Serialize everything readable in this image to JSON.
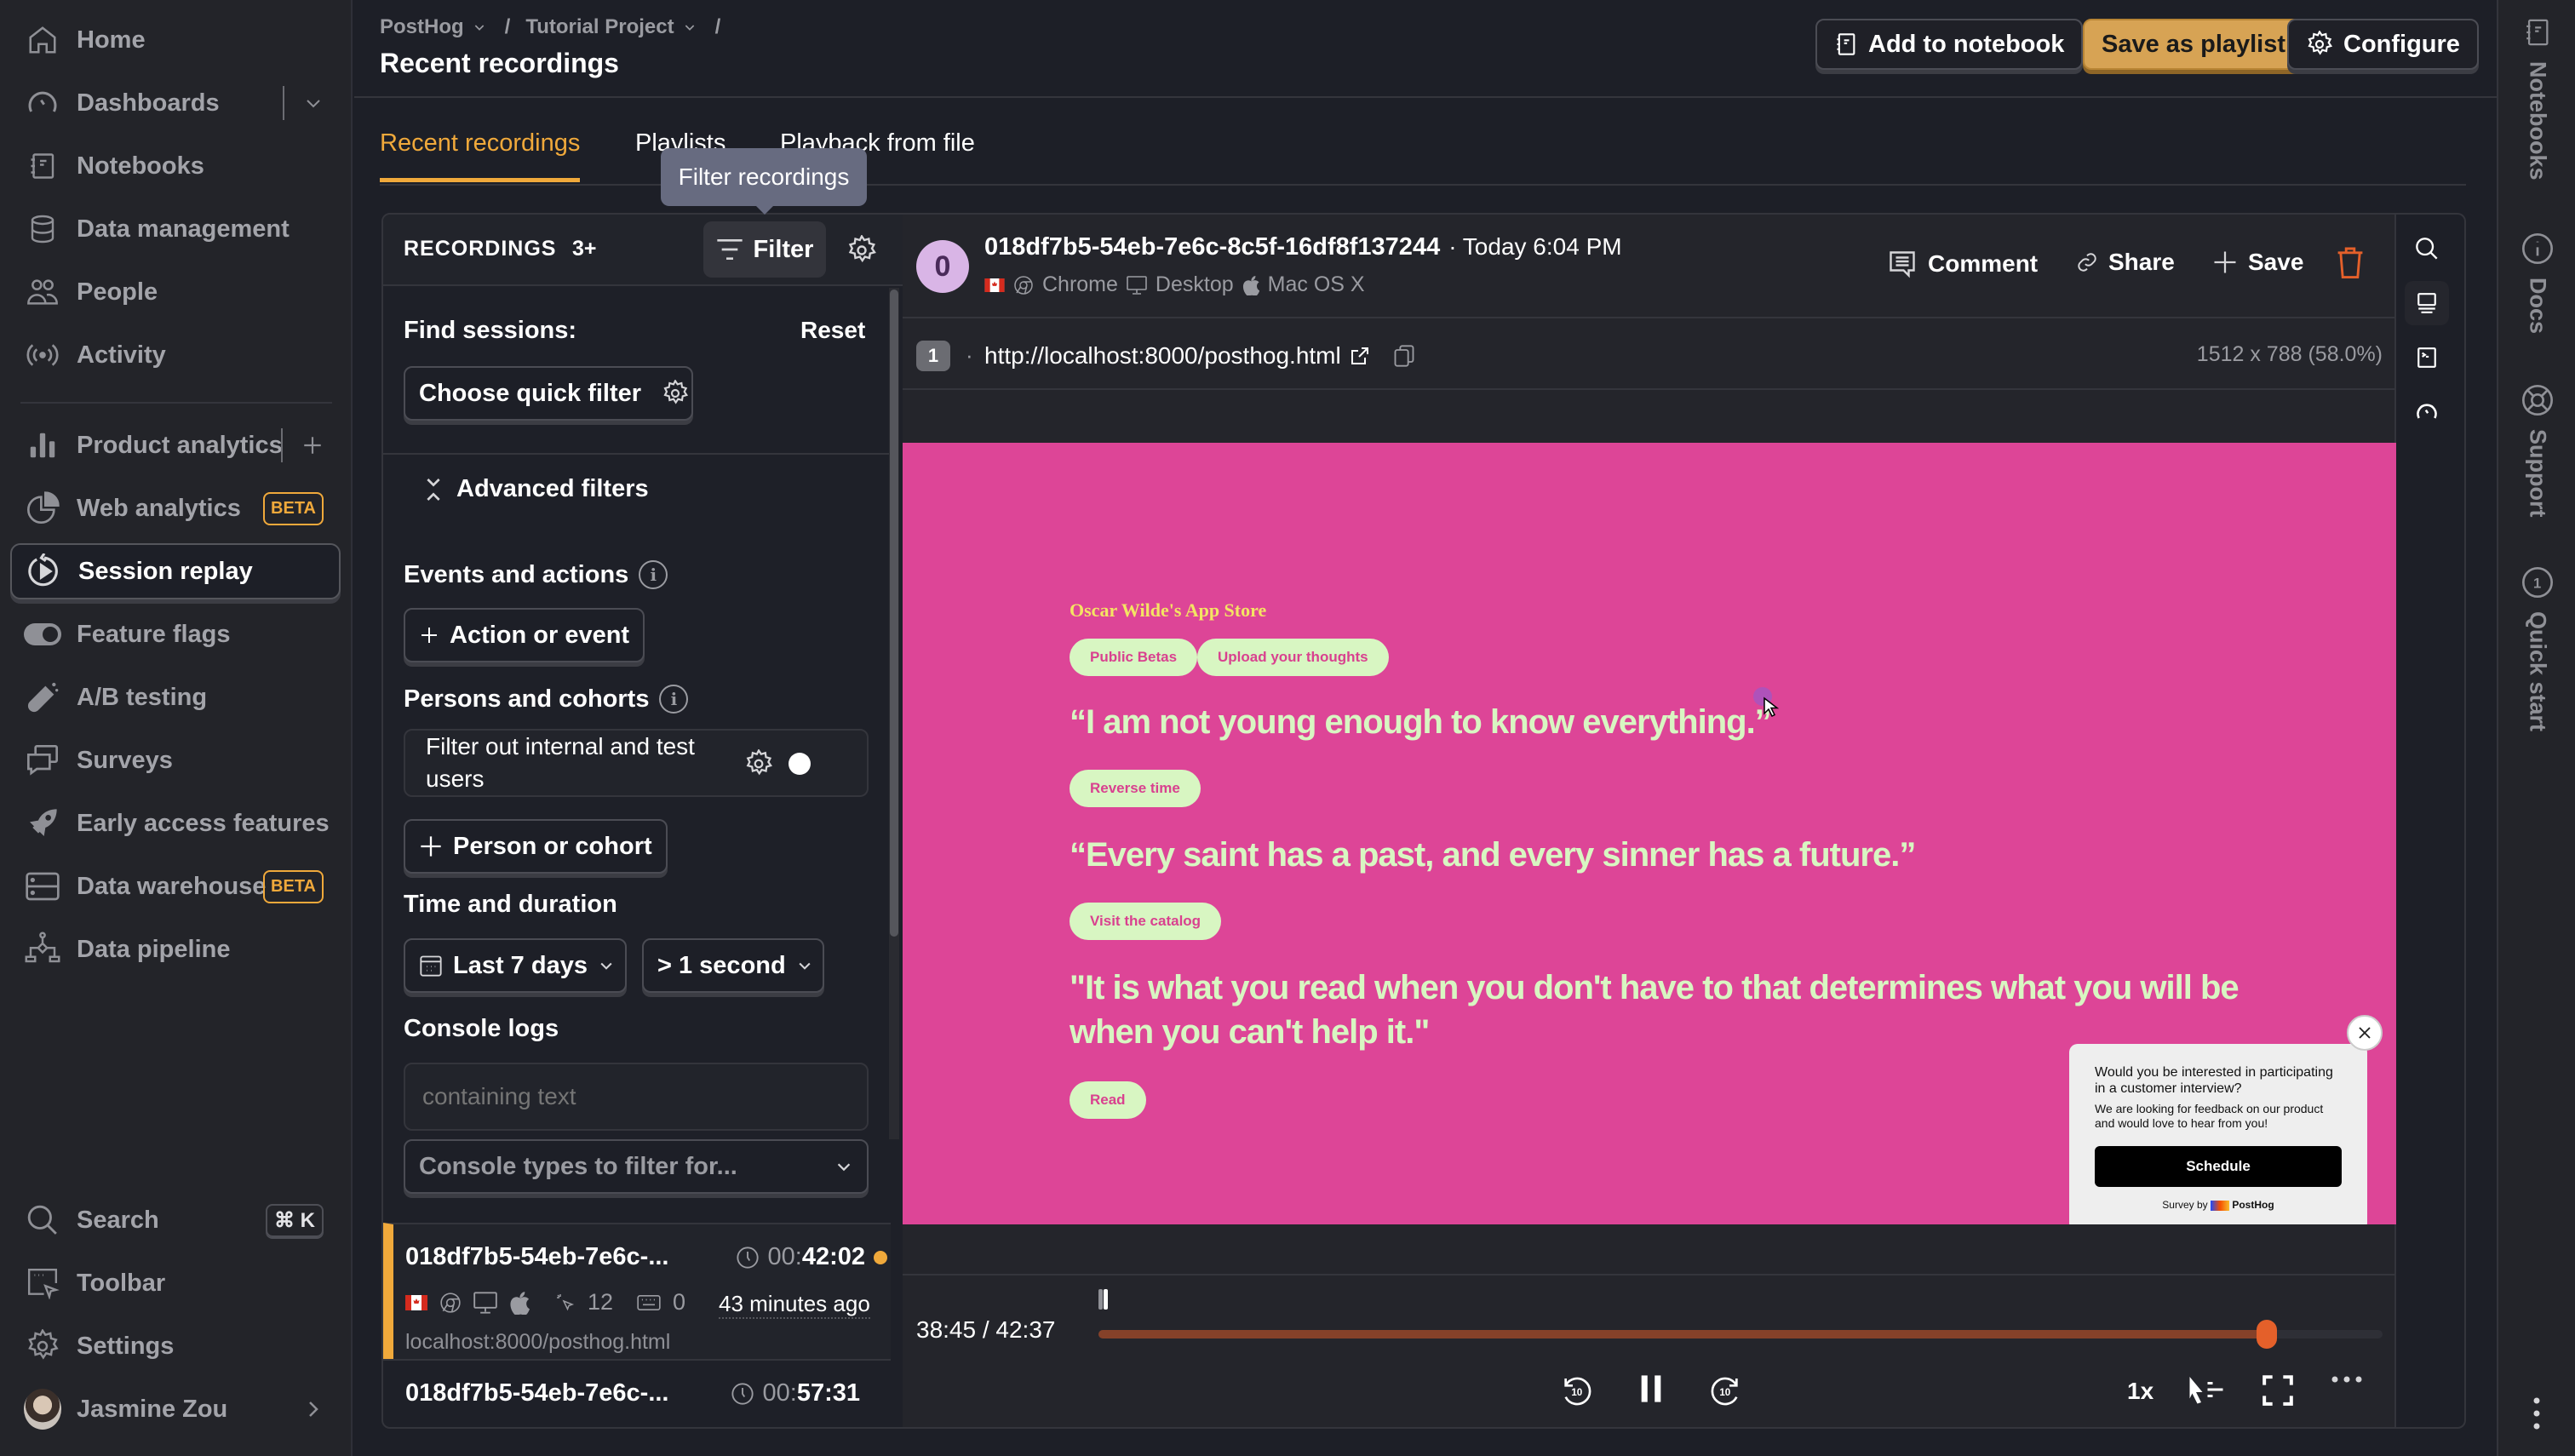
{
  "sidebar": {
    "items": [
      {
        "label": "Home",
        "icon": "home-icon"
      },
      {
        "label": "Dashboards",
        "icon": "dashboard-icon"
      },
      {
        "label": "Notebooks",
        "icon": "notebook-icon"
      },
      {
        "label": "Data management",
        "icon": "database-icon"
      },
      {
        "label": "People",
        "icon": "people-icon"
      },
      {
        "label": "Activity",
        "icon": "activity-icon"
      },
      {
        "label": "Product analytics",
        "icon": "bar-chart-icon"
      },
      {
        "label": "Web analytics",
        "icon": "pie-chart-icon",
        "badge": "BETA"
      },
      {
        "label": "Session replay",
        "icon": "replay-icon",
        "active": true
      },
      {
        "label": "Feature flags",
        "icon": "toggle-icon"
      },
      {
        "label": "A/B testing",
        "icon": "flask-icon"
      },
      {
        "label": "Surveys",
        "icon": "chat-icon"
      },
      {
        "label": "Early access features",
        "icon": "rocket-icon"
      },
      {
        "label": "Data warehouse",
        "icon": "server-icon",
        "badge": "BETA"
      },
      {
        "label": "Data pipeline",
        "icon": "pipeline-icon"
      }
    ],
    "bottom": {
      "search": "Search",
      "search_shortcut": "⌘ K",
      "toolbar": "Toolbar",
      "settings": "Settings",
      "user": "Jasmine Zou"
    }
  },
  "header": {
    "breadcrumbs": [
      "PostHog",
      "Tutorial Project"
    ],
    "separator": "/",
    "title": "Recent recordings",
    "buttons": {
      "add_to_notebook": "Add to notebook",
      "save_as_playlist": "Save as playlist",
      "configure": "Configure"
    }
  },
  "tabs": [
    {
      "label": "Recent recordings",
      "active": true
    },
    {
      "label": "Playlists"
    },
    {
      "label": "Playback from file"
    }
  ],
  "tooltip": "Filter recordings",
  "recordings": {
    "title": "RECORDINGS",
    "count": "3+",
    "filter_label": "Filter",
    "find_sessions": "Find sessions:",
    "reset": "Reset",
    "quick_filter": "Choose quick filter",
    "advanced_filters": "Advanced filters",
    "events_title": "Events and actions",
    "action_or_event": "Action or event",
    "persons_title": "Persons and cohorts",
    "filter_internal": "Filter out internal and test users",
    "filter_internal_enabled": false,
    "person_or_cohort": "Person or cohort",
    "time_title": "Time and duration",
    "date_range": "Last 7 days",
    "duration": "> 1 second",
    "console_title": "Console logs",
    "console_placeholder": "containing text",
    "console_types_placeholder": "Console types to filter for...",
    "list": [
      {
        "id": "018df7b5-54eb-7e6c-...",
        "duration_prefix": "00:",
        "duration": "42:02",
        "clicks": "12",
        "keypresses": "0",
        "ago": "43 minutes ago",
        "url": "localhost:8000/posthog.html",
        "active": true,
        "unwatched": true
      },
      {
        "id": "018df7b5-54eb-7e6c-...",
        "duration_prefix": "00:",
        "duration": "57:31"
      }
    ]
  },
  "player": {
    "avatar_letter": "0",
    "session_id": "018df7b5-54eb-7e6c-8c5f-16df8f137244",
    "timestamp": "· Today 6:04 PM",
    "browser": "Chrome",
    "device": "Desktop",
    "os": "Mac OS X",
    "actions": {
      "comment": "Comment",
      "share": "Share",
      "save": "Save"
    },
    "page_index": "1",
    "url": "http://localhost:8000/posthog.html",
    "resolution": "1512 x 788 (58.0%)",
    "current_time": "38:45",
    "total_time": "42:37",
    "time_display": "38:45 / 42:37",
    "progress": 0.9096,
    "speed": "1x",
    "colors": {
      "accent": "#f0a93b",
      "seek": "#e4602a",
      "delete": "#e4602a",
      "site_bg": "#dd4597",
      "site_fg": "#d8f6c2"
    }
  },
  "site": {
    "brand": "Oscar Wilde's App Store",
    "nav": [
      "Public Betas",
      "Upload your thoughts"
    ],
    "quote1": "“I am not young enough to know everything.”",
    "btn1": "Reverse time",
    "quote2": "“Every saint has a past, and every sinner has a future.”",
    "btn2": "Visit the catalog",
    "quote3": "\"It is what you read when you don't have to that determines what you will be when you can't help it.\"",
    "btn3": "Read",
    "survey": {
      "question": "Would you be interested in participating in a customer interview?",
      "description": "We are looking for feedback on our product and would love to hear from you!",
      "button": "Schedule",
      "footer": "Survey by",
      "brand": "PostHog"
    }
  },
  "right_panel": [
    "Notebooks",
    "Docs",
    "Support",
    "Quick start"
  ]
}
